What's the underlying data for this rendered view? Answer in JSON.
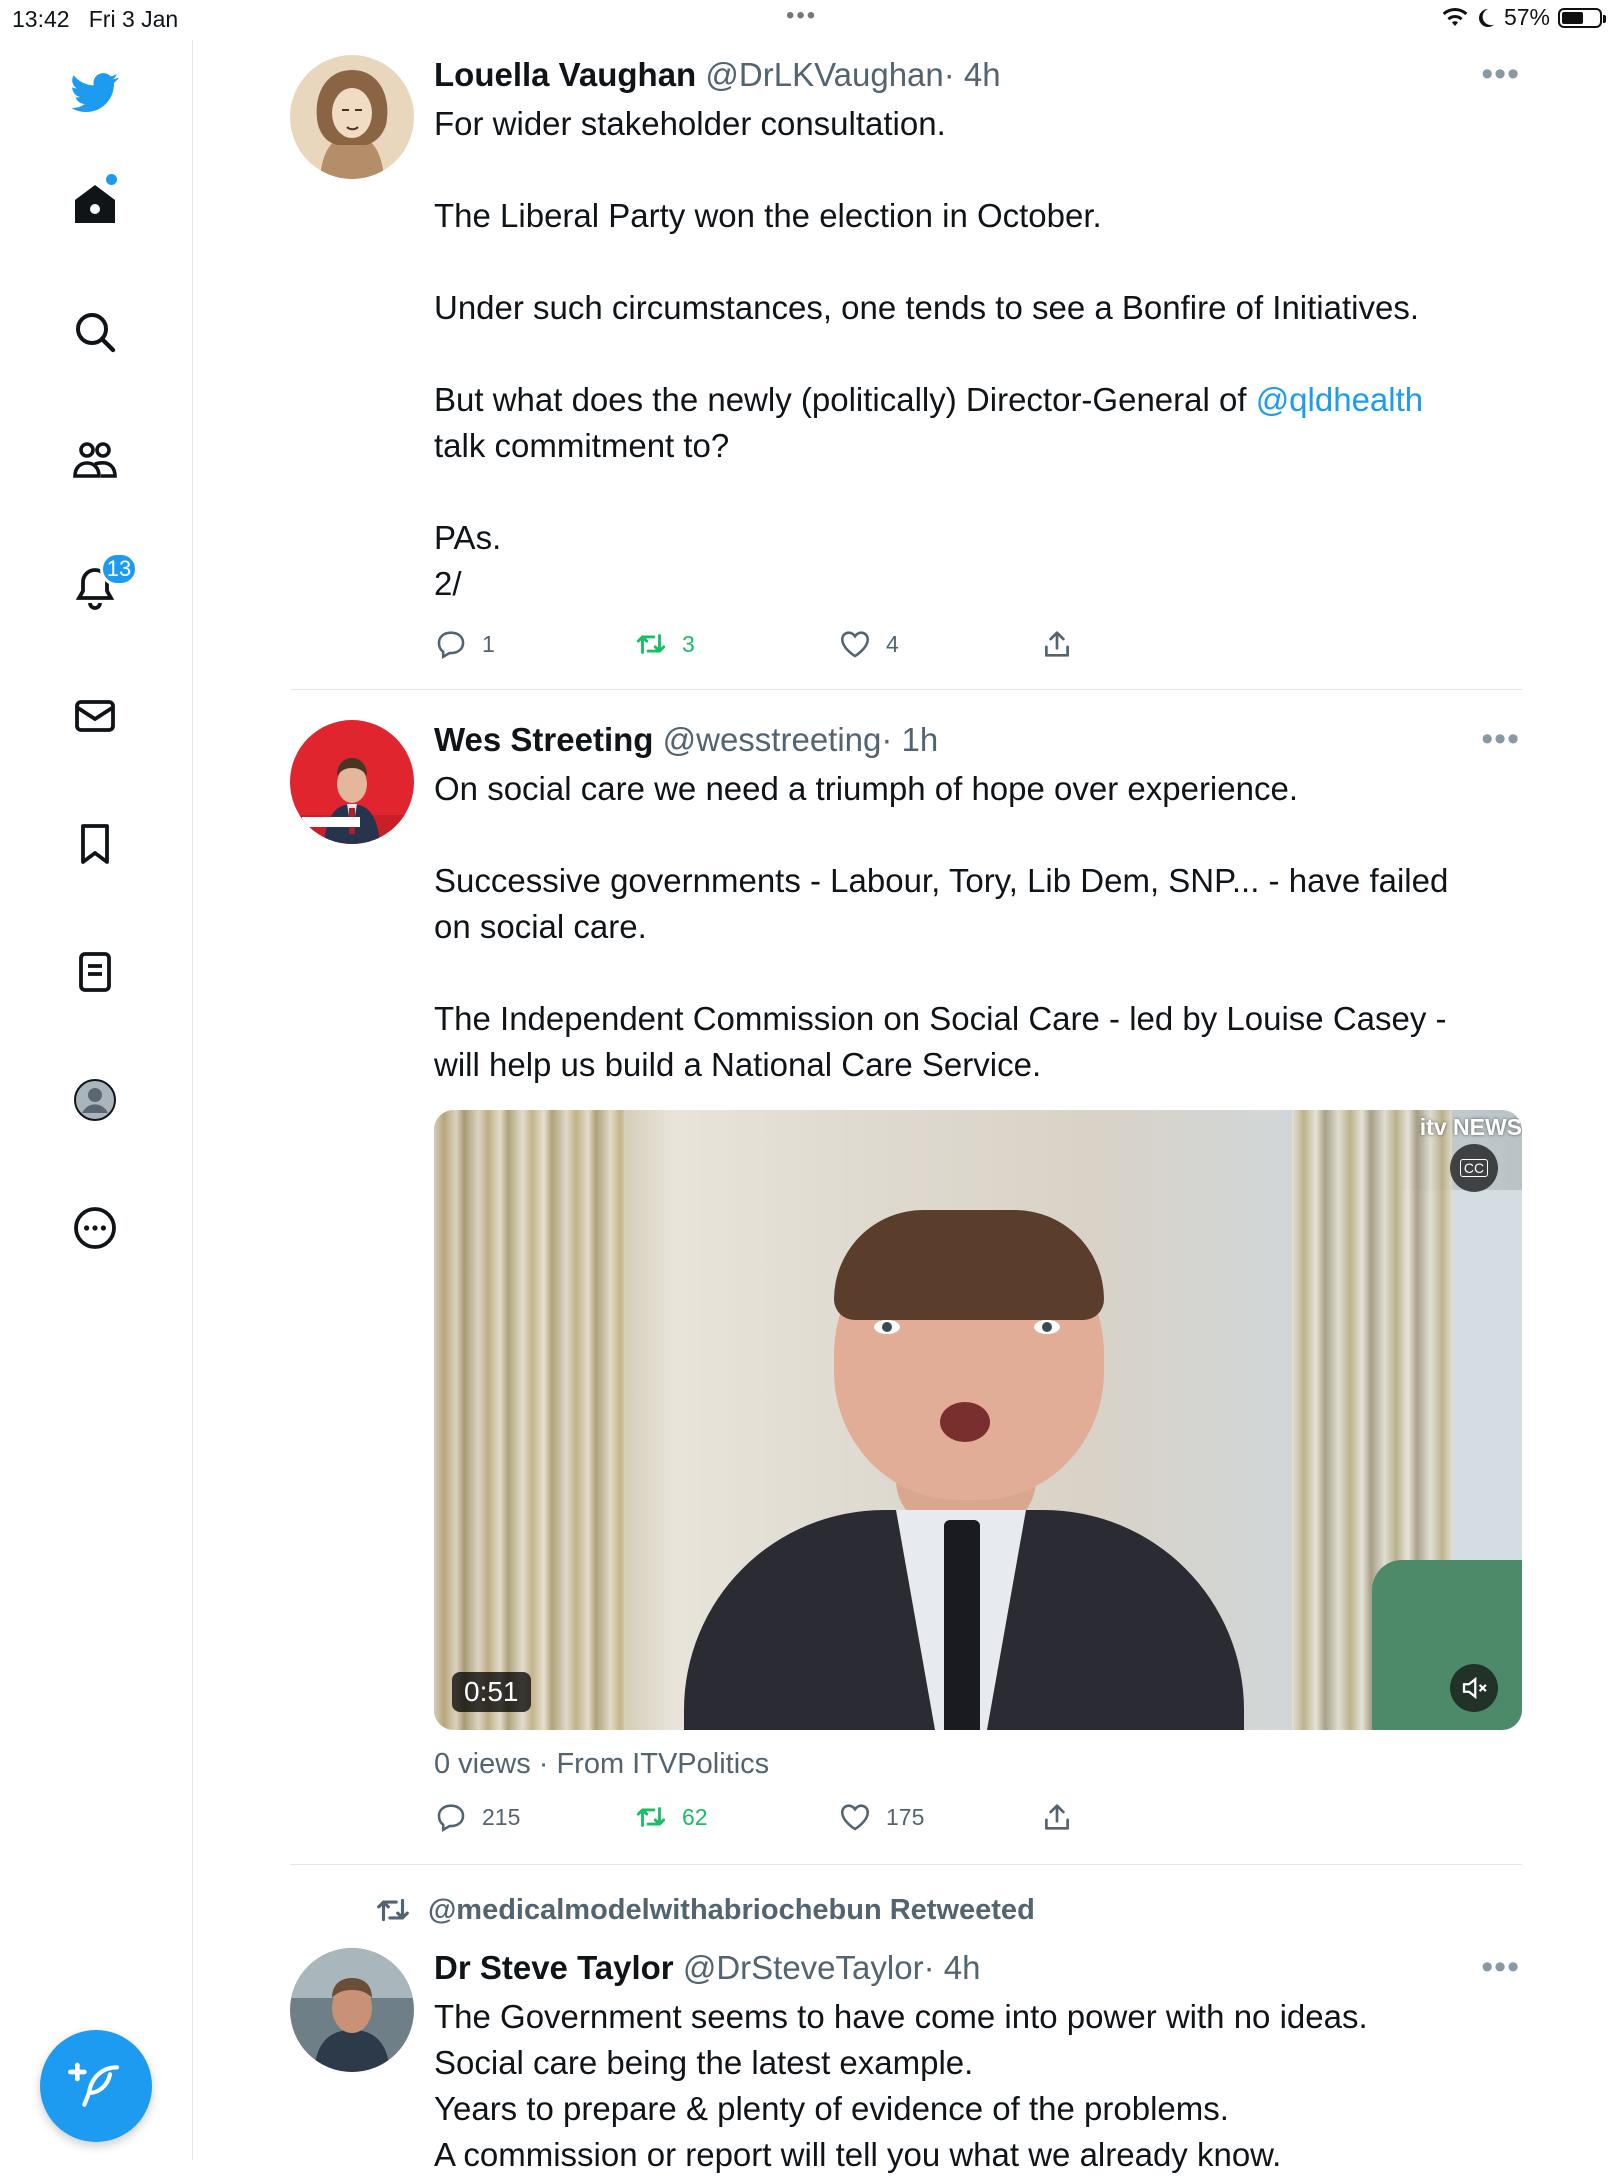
{
  "status_bar": {
    "time": "13:42",
    "date": "Fri 3 Jan",
    "center_dots": "•••",
    "battery_percent": "57%",
    "battery_level": 0.57
  },
  "sidebar": {
    "items": [
      {
        "name": "twitter-logo-icon"
      },
      {
        "name": "home-icon"
      },
      {
        "name": "search-icon"
      },
      {
        "name": "communities-icon"
      },
      {
        "name": "notifications-icon"
      },
      {
        "name": "messages-icon"
      },
      {
        "name": "bookmarks-icon"
      },
      {
        "name": "lists-icon"
      },
      {
        "name": "profile-icon"
      },
      {
        "name": "more-icon"
      }
    ],
    "notifications_badge": "13"
  },
  "colors": {
    "accent": "#1d9bf0",
    "retweet": "#17bf63",
    "secondary_text": "#536471"
  },
  "tweets": [
    {
      "name": "Louella Vaughan",
      "handle": "@DrLKVaughan",
      "time": "· 4h",
      "more": "•••",
      "lines": [
        "For wider stakeholder consultation.",
        "The Liberal Party won the election in October.",
        "Under such circumstances, one tends to see a Bonfire of Initiatives.",
        "But what does the newly (politically) Director-General of ",
        "@qldhealth",
        "talk commitment to?",
        "PAs.",
        "2/"
      ],
      "replies": "1",
      "retweets": "3",
      "likes": "4"
    },
    {
      "name": "Wes Streeting",
      "handle": "@wesstreeting",
      "time": "· 1h",
      "more": "•••",
      "lines": [
        "On social care we need a triumph of hope over experience.",
        "Successive governments - Labour, Tory, Lib Dem, SNP... - have failed",
        "on social care.",
        "The Independent Commission on Social Care - led by Louise Casey -",
        "will help us build a National Care Service."
      ],
      "video": {
        "duration": "0:51",
        "channel_logo": "itv NEWS",
        "cc_label": "CC"
      },
      "views_line": "0 views · From ITVPolitics",
      "replies": "215",
      "retweets": "62",
      "likes": "175"
    },
    {
      "retweeted_by": "@medicalmodelwithabriochebun Retweeted",
      "name": "Dr Steve Taylor",
      "handle": "@DrSteveTaylor",
      "time": "· 4h",
      "more": "•••",
      "lines": [
        "The Government seems to have come into power with no ideas.",
        "Social care being the latest example.",
        "Years to prepare & plenty of evidence of the problems.",
        "A commission or report will tell you what we already know."
      ]
    }
  ]
}
